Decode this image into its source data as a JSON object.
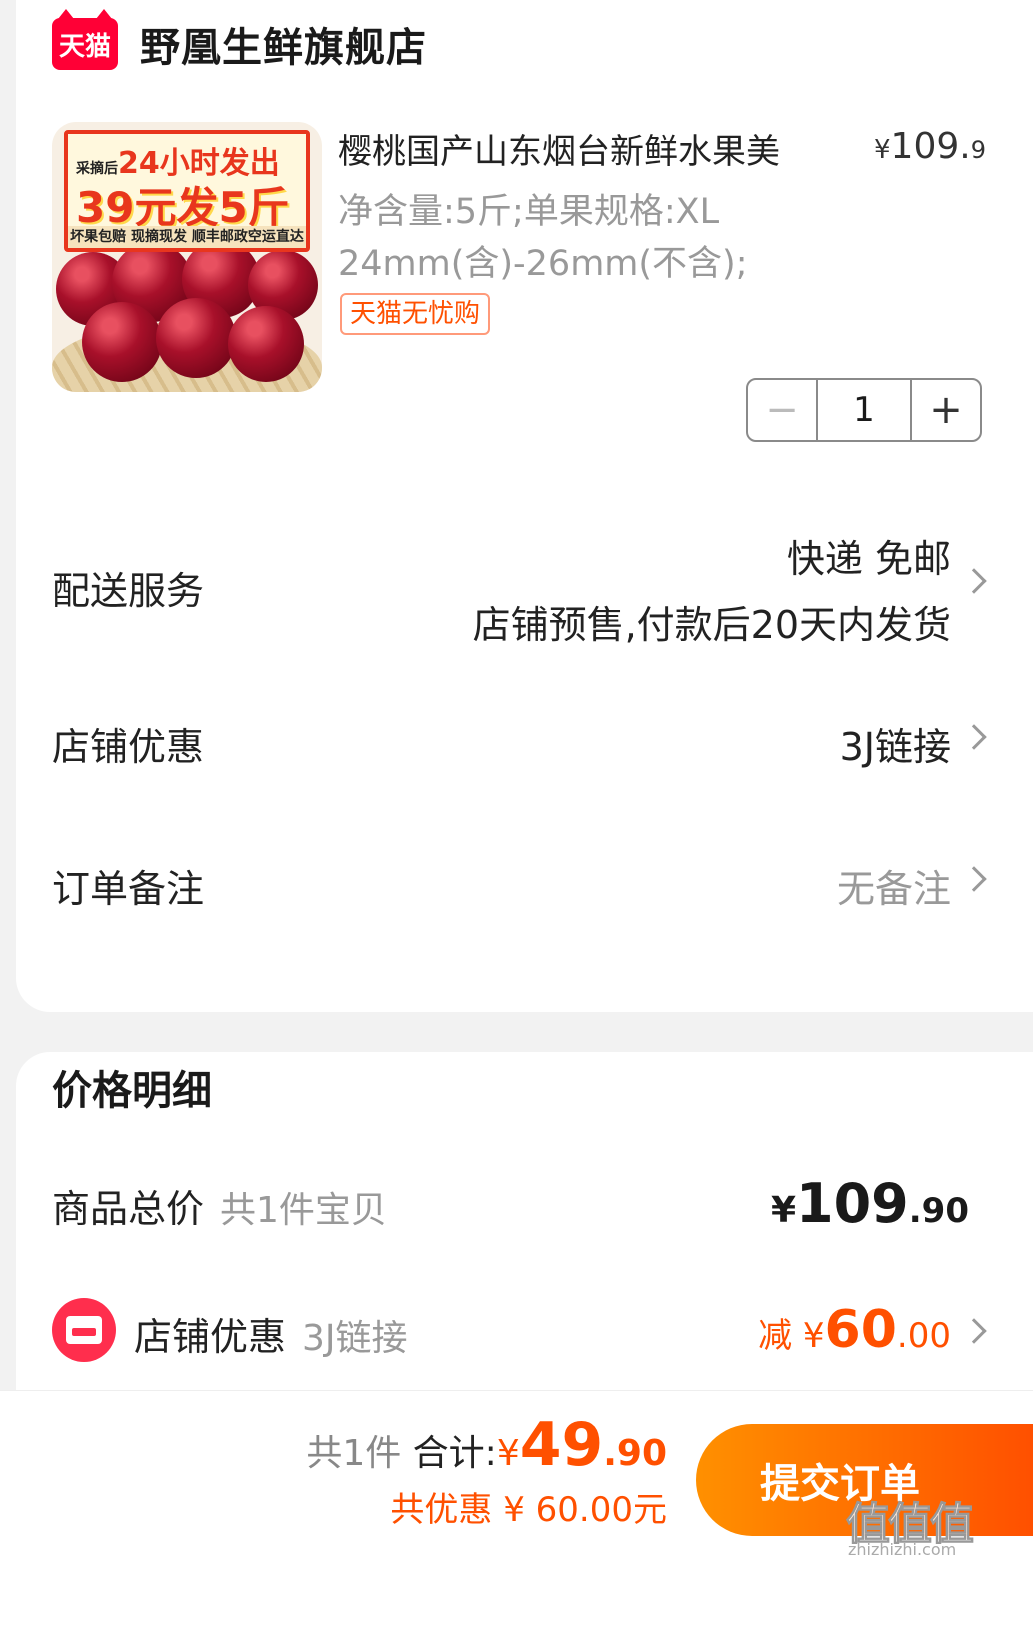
{
  "store": {
    "badge": "天猫",
    "name": "野凰生鲜旗舰店"
  },
  "product": {
    "image_banner": {
      "line1_small": "采摘后",
      "line1": "24小时发出",
      "line2": "39元发5斤",
      "line3": "坏果包赔 现摘现发 顺丰邮政空运直达"
    },
    "title": "樱桃国产山东烟台新鲜水果美",
    "price_symbol": "¥",
    "price_int": "109.",
    "price_dec": "9",
    "spec": "净含量:5斤;单果规格:XL 24mm(含)-26mm(不含);",
    "tag": "天猫无忧购",
    "quantity": "1",
    "minus": "−",
    "plus": "+"
  },
  "rows": {
    "delivery": {
      "label": "配送服务",
      "value1": "快递 免邮",
      "value2": "店铺预售,付款后20天内发货"
    },
    "store_discount": {
      "label": "店铺优惠",
      "value": "3J链接"
    },
    "note": {
      "label": "订单备注",
      "value": "无备注"
    }
  },
  "price_detail": {
    "title": "价格明细",
    "goods_total_label": "商品总价",
    "goods_count": "共1件宝贝",
    "total_symbol": "¥",
    "total_int": "109",
    "total_dec": ".90",
    "discount_label": "店铺优惠",
    "discount_sub": "3J链接",
    "discount_prefix": "减",
    "discount_symbol": "¥",
    "discount_int": "60",
    "discount_dec": ".00"
  },
  "footer": {
    "count": "共1件",
    "sum_label": "合计:",
    "sum_symbol": "¥",
    "sum_int": "49",
    "sum_dec": ".90",
    "saved": "共优惠 ¥ 60.00元",
    "submit": "提交订单",
    "watermark": "值值值",
    "watermark_sub": "zhizhizhi.com"
  },
  "colors": {
    "accent": "#ff5000",
    "tmall_red": "#ff0036",
    "button_start": "#ff9000"
  }
}
